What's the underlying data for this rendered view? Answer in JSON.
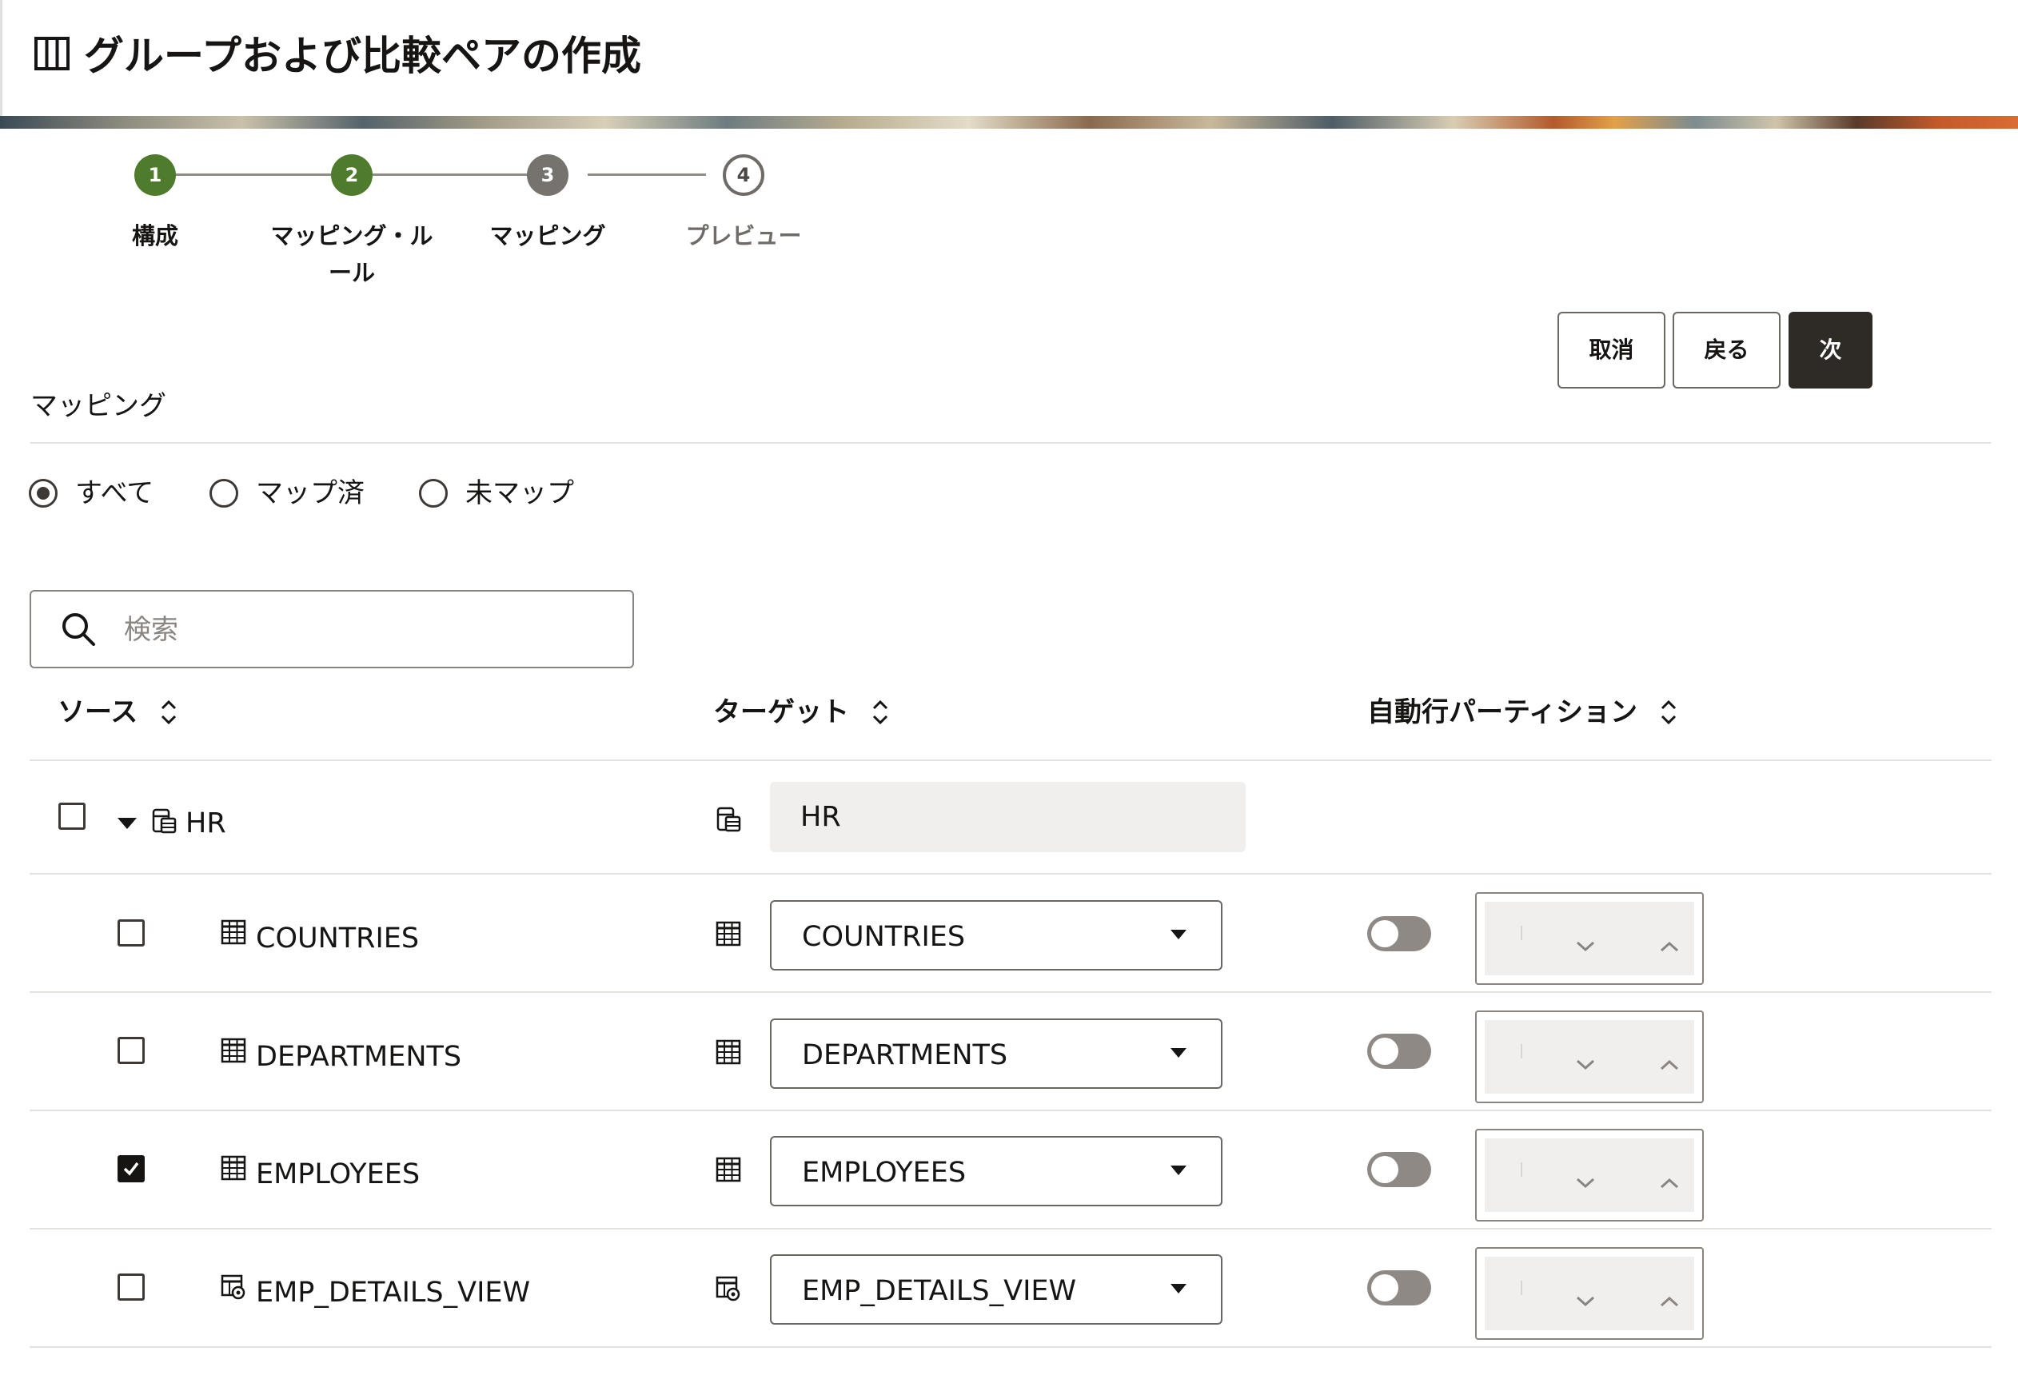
{
  "header": {
    "title": "グループおよび比較ペアの作成",
    "icon": "columns-icon"
  },
  "train": {
    "steps": [
      {
        "number": "1",
        "label": "構成",
        "state": "done"
      },
      {
        "number": "2",
        "label": "マッピング・ルール",
        "label_line1": "マッピング・ル",
        "label_line2": "ール",
        "state": "done"
      },
      {
        "number": "3",
        "label": "マッピング",
        "state": "current"
      },
      {
        "number": "4",
        "label": "プレビュー",
        "state": "todo"
      }
    ],
    "colors": {
      "done": "#4f7b2c",
      "current": "#76726e",
      "todo_border": "#6f6b67"
    }
  },
  "actions": {
    "cancel_label": "取消",
    "back_label": "戻る",
    "next_label": "次"
  },
  "mapping": {
    "section_title": "マッピング",
    "filter": {
      "options": [
        "すべて",
        "マップ済",
        "未マップ"
      ],
      "selected": "すべて"
    },
    "search": {
      "placeholder": "検索",
      "value": ""
    },
    "columns": {
      "source": "ソース",
      "target": "ターゲット",
      "auto_partition": "自動行パーティション"
    },
    "schema_row": {
      "source": "HR",
      "target": "HR",
      "checked": false,
      "expanded": true,
      "icon": "database-icon"
    },
    "rows": [
      {
        "source": "COUNTRIES",
        "target": "COUNTRIES",
        "checked": false,
        "type": "table",
        "icon": "table-icon",
        "auto_partition": false,
        "partition_value": ""
      },
      {
        "source": "DEPARTMENTS",
        "target": "DEPARTMENTS",
        "checked": false,
        "type": "table",
        "icon": "table-icon",
        "auto_partition": false,
        "partition_value": ""
      },
      {
        "source": "EMPLOYEES",
        "target": "EMPLOYEES",
        "checked": true,
        "type": "table",
        "icon": "table-icon",
        "auto_partition": false,
        "partition_value": ""
      },
      {
        "source": "EMP_DETAILS_VIEW",
        "target": "EMP_DETAILS_VIEW",
        "checked": false,
        "type": "view",
        "icon": "view-icon",
        "auto_partition": false,
        "partition_value": ""
      }
    ]
  },
  "colors": {
    "primary_button": "#2e2a26",
    "toggle_off": "#8e8984",
    "readonly_bg": "#f1efed",
    "separator": "#e4e2df"
  }
}
